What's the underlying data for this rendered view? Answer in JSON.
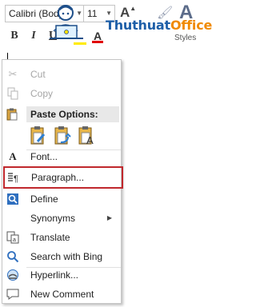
{
  "toolbar": {
    "font_name": "Calibri (Body)",
    "font_size": "11",
    "grow_label": "A",
    "bold_label": "B",
    "italic_label": "I",
    "underline_label": "U",
    "font_color_label": "A",
    "styles_label": "Styles",
    "styles_glyph": "A",
    "font_color": "#e00000",
    "highlight_color": "#ffeb00"
  },
  "logo": {
    "part1": "Thuthuat",
    "part2": "Office"
  },
  "menu": {
    "items": [
      {
        "label": "Cut",
        "enabled": false,
        "icon": "scissors-icon"
      },
      {
        "label": "Copy",
        "enabled": false,
        "icon": "copy-icon"
      },
      {
        "label": "Font...",
        "enabled": true,
        "icon": "font-icon"
      },
      {
        "label": "Paragraph...",
        "enabled": true,
        "icon": "paragraph-icon",
        "highlighted": true
      },
      {
        "label": "Define",
        "enabled": true,
        "icon": "define-icon"
      },
      {
        "label": "Synonyms",
        "enabled": true,
        "icon": "none",
        "submenu": true
      },
      {
        "label": "Translate",
        "enabled": true,
        "icon": "translate-icon"
      },
      {
        "label": "Search with Bing",
        "enabled": true,
        "icon": "search-icon"
      },
      {
        "label": "Hyperlink...",
        "enabled": true,
        "icon": "hyperlink-icon"
      },
      {
        "label": "New Comment",
        "enabled": true,
        "icon": "comment-icon"
      }
    ],
    "paste_options_label": "Paste Options:",
    "highlight_border_color": "#c0282d"
  }
}
